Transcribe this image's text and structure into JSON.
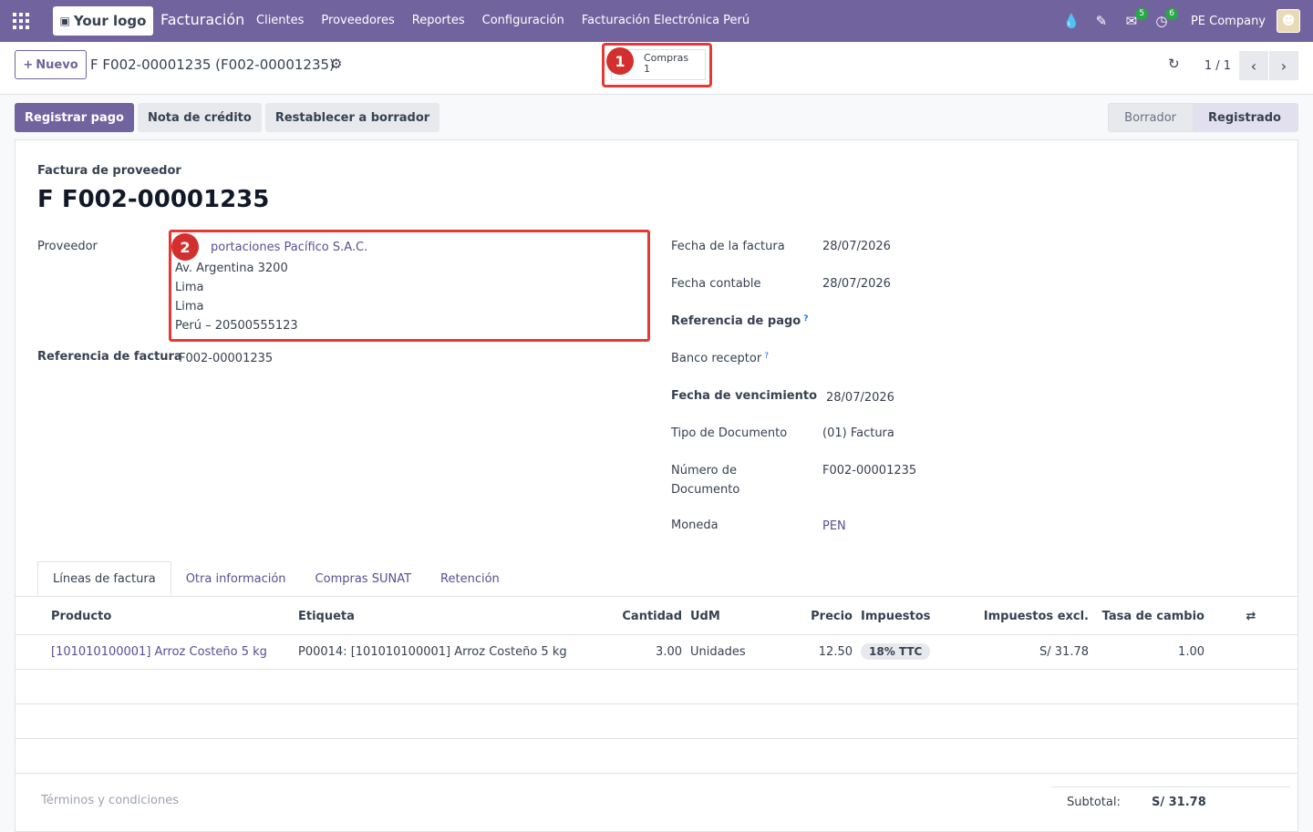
{
  "navbar": {
    "logo": "Your logo",
    "app": "Facturación",
    "menu": [
      "Clientes",
      "Proveedores",
      "Reportes",
      "Configuración",
      "Facturación Electrónica Perú"
    ],
    "messages_count": "5",
    "activities_count": "6",
    "company": "PE Company"
  },
  "control": {
    "new_label": "Nuevo",
    "breadcrumb": "F F002-00001235 (F002-00001235)",
    "smart_label": "Compras",
    "smart_count": "1",
    "pager": "1 / 1"
  },
  "statusbar": {
    "register_payment": "Registrar pago",
    "credit_note": "Nota de crédito",
    "reset_draft": "Restablecer a borrador",
    "state_draft": "Borrador",
    "state_posted": "Registrado"
  },
  "annotations": {
    "one": "1",
    "two": "2"
  },
  "form": {
    "type": "Factura de proveedor",
    "name": "F F002-00001235",
    "vendor_label": "Proveedor",
    "vendor_name": "portaciones Pacífico S.A.C.",
    "vendor_street": "Av. Argentina 3200",
    "vendor_city": "Lima",
    "vendor_state": "Lima",
    "vendor_country": "Perú – 20500555123",
    "bill_ref_label": "Referencia de factura",
    "bill_ref": "F002-00001235",
    "invoice_date_label": "Fecha de la factura",
    "invoice_date": "28/07/2026",
    "accounting_date_label": "Fecha contable",
    "accounting_date": "28/07/2026",
    "payment_ref_label": "Referencia de pago",
    "bank_label": "Banco receptor",
    "due_date_label": "Fecha de vencimiento",
    "due_date": "28/07/2026",
    "doc_type_label": "Tipo de Documento",
    "doc_type": "(01) Factura",
    "doc_number_label_1": "Número de",
    "doc_number_label_2": "Documento",
    "doc_number": "F002-00001235",
    "currency_label": "Moneda",
    "currency": "PEN"
  },
  "tabs": [
    "Líneas de factura",
    "Otra información",
    "Compras SUNAT",
    "Retención"
  ],
  "lines": {
    "headers": [
      "Producto",
      "Etiqueta",
      "Cantidad",
      "UdM",
      "Precio",
      "Impuestos",
      "Impuestos excl.",
      "Tasa de cambio"
    ],
    "rows": [
      {
        "product": "[101010100001] Arroz Costeño 5 kg",
        "label": "P00014: [101010100001] Arroz Costeño 5 kg",
        "qty": "3.00",
        "uom": "Unidades",
        "price": "12.50",
        "tax": "18% TTC",
        "subtotal": "S/ 31.78",
        "rate": "1.00"
      }
    ]
  },
  "footer": {
    "terms_placeholder": "Términos y condiciones",
    "subtotal_label": "Subtotal:",
    "subtotal_value": "S/ 31.78"
  }
}
